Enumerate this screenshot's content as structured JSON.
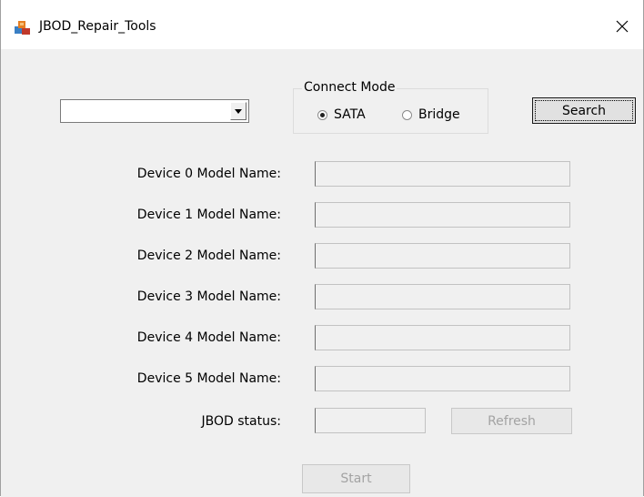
{
  "window": {
    "title": "JBOD_Repair_Tools"
  },
  "connect_mode": {
    "legend": "Connect Mode",
    "options": [
      {
        "label": "SATA",
        "selected": true
      },
      {
        "label": "Bridge",
        "selected": false
      }
    ]
  },
  "device_combo": {
    "value": ""
  },
  "buttons": {
    "search": "Search",
    "refresh": "Refresh",
    "start": "Start"
  },
  "devices": [
    {
      "label": "Device 0 Model Name:",
      "value": ""
    },
    {
      "label": "Device 1 Model Name:",
      "value": ""
    },
    {
      "label": "Device 2 Model Name:",
      "value": ""
    },
    {
      "label": "Device 3 Model Name:",
      "value": ""
    },
    {
      "label": "Device 4 Model Name:",
      "value": ""
    },
    {
      "label": "Device 5 Model Name:",
      "value": ""
    }
  ],
  "status": {
    "label": "JBOD status:",
    "value": ""
  },
  "colors": {
    "window_bg": "#f0f0f0",
    "titlebar_bg": "#ffffff",
    "disabled_text": "#a3a3a3"
  }
}
